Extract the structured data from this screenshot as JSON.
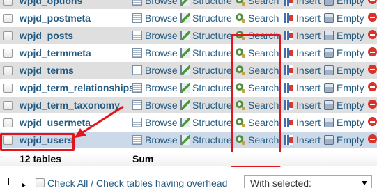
{
  "tables": [
    {
      "name": "wpjd_options"
    },
    {
      "name": "wpjd_postmeta"
    },
    {
      "name": "wpjd_posts"
    },
    {
      "name": "wpjd_termmeta"
    },
    {
      "name": "wpjd_terms"
    },
    {
      "name": "wpjd_term_relationships"
    },
    {
      "name": "wpjd_term_taxonomy"
    },
    {
      "name": "wpjd_usermeta"
    },
    {
      "name": "wpjd_users"
    }
  ],
  "actions": {
    "browse": "Browse",
    "structure": "Structure",
    "search": "Search",
    "insert": "Insert",
    "empty": "Empty"
  },
  "summary": {
    "tables_count": "12 tables",
    "sum": "Sum"
  },
  "footer": {
    "check_all": "Check All",
    "separator": " / ",
    "check_overhead": "Check tables having overhead",
    "with_selected": "With selected:"
  },
  "colors": {
    "link": "#235a81",
    "highlight_red": "#e3141d",
    "row_alt": "#dfdfdf",
    "row_hover": "#ccd9e8"
  }
}
